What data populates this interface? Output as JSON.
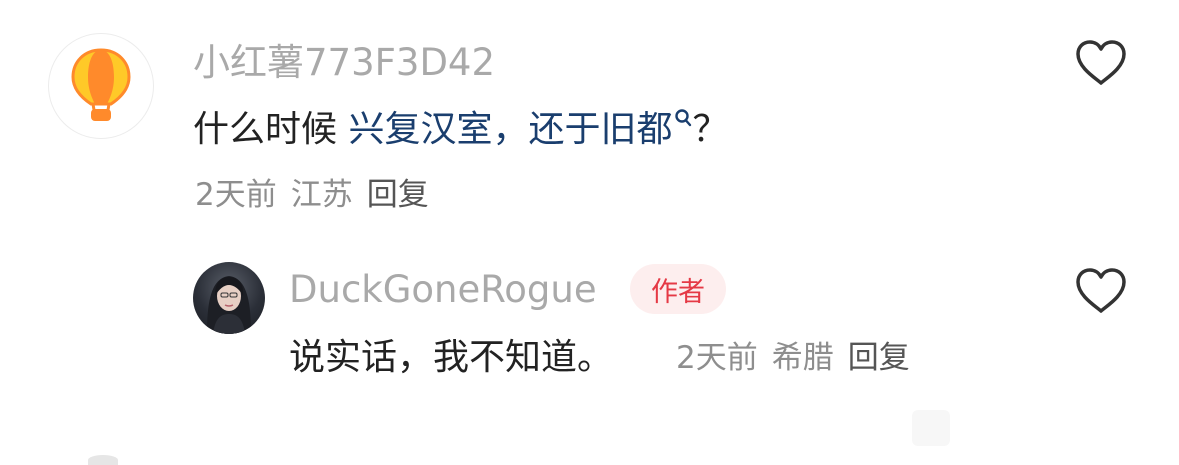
{
  "comment": {
    "username": "小红薯773F3D42",
    "text_prefix": "什么时候 ",
    "link1": "兴复汉室，",
    "link2": "还于旧都",
    "text_suffix": "？",
    "time": "2天前",
    "location": "江苏",
    "reply_label": "回复",
    "avatar_icon": "hot-air-balloon-icon"
  },
  "reply": {
    "username": "DuckGoneRogue",
    "badge": "作者",
    "text": "说实话，我不知道。",
    "time": "2天前",
    "location": "希腊",
    "reply_label": "回复"
  },
  "icons": {
    "like": "heart-outline-icon",
    "search": "search-icon"
  },
  "colors": {
    "username": "#a9a9a9",
    "link": "#1a3e6e",
    "badge_text": "#e53945",
    "badge_bg": "#fdeeee",
    "balloon_orange": "#ff8a2b",
    "balloon_yellow": "#ffc928"
  }
}
